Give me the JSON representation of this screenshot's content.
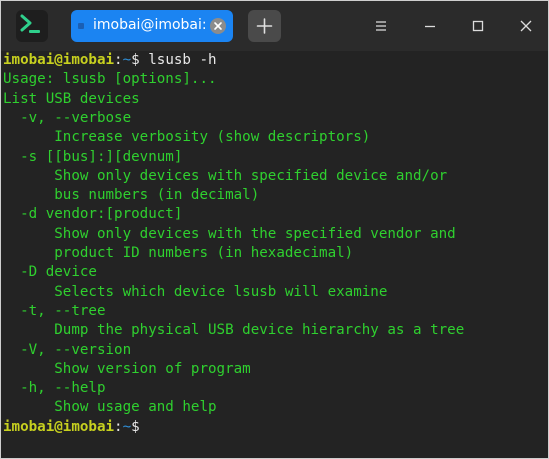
{
  "window": {
    "tab_title": "imobai@imobai: ~",
    "icons": {
      "app": "terminal-app-icon",
      "tab_close": "close-icon",
      "new_tab": "plus-icon",
      "menu": "hamburger-icon",
      "minimize": "minimize-icon",
      "maximize": "maximize-icon",
      "close": "close-icon"
    }
  },
  "colors": {
    "background": "#232323",
    "tab_active": "#1b84f2",
    "output_text": "#2fd02f",
    "prompt_user": "#c7d01f",
    "prompt_path": "#2f8fd8"
  },
  "terminal": {
    "prompt_user": "imobai@imobai",
    "prompt_sep": ":",
    "prompt_path": "~",
    "prompt_symbol": "$ ",
    "command": "lsusb -h",
    "output": [
      "Usage: lsusb [options]...",
      "List USB devices",
      "  -v, --verbose",
      "      Increase verbosity (show descriptors)",
      "  -s [[bus]:][devnum]",
      "      Show only devices with specified device and/or",
      "      bus numbers (in decimal)",
      "  -d vendor:[product]",
      "      Show only devices with the specified vendor and",
      "      product ID numbers (in hexadecimal)",
      "  -D device",
      "      Selects which device lsusb will examine",
      "  -t, --tree",
      "      Dump the physical USB device hierarchy as a tree",
      "  -V, --version",
      "      Show version of program",
      "  -h, --help",
      "      Show usage and help"
    ]
  }
}
